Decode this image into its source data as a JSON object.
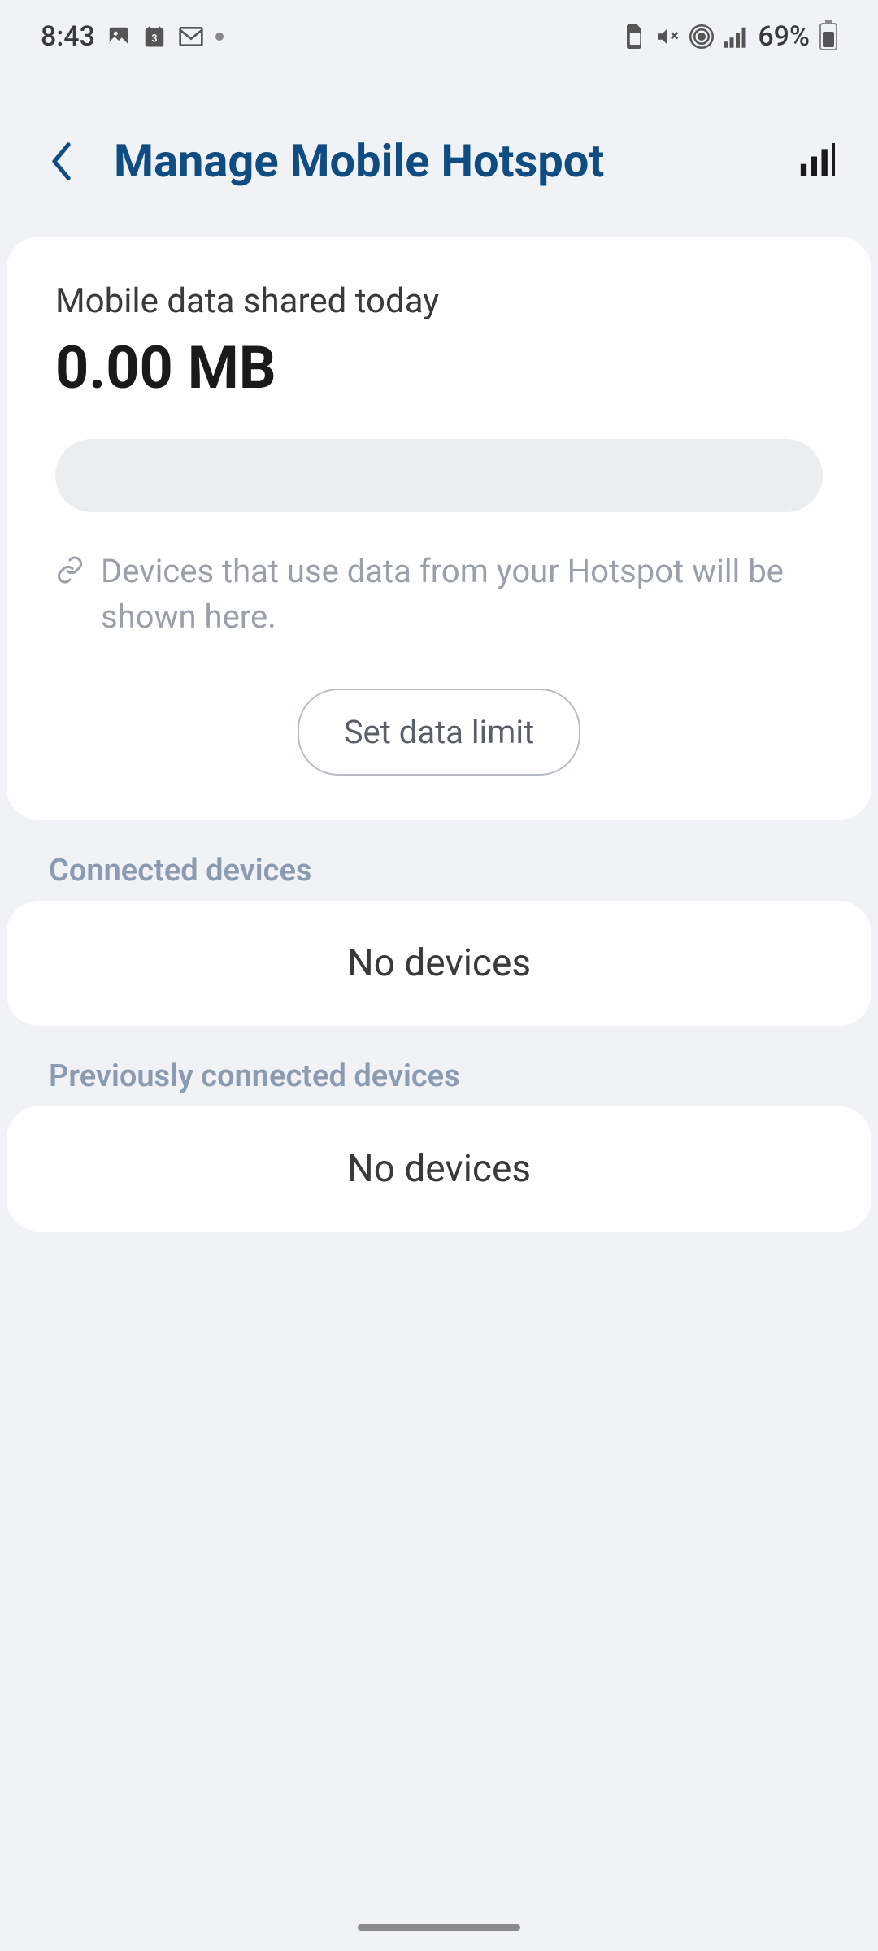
{
  "status_bar": {
    "time": "8:43",
    "battery_percent": "69%"
  },
  "header": {
    "title": "Manage Mobile Hotspot"
  },
  "data_card": {
    "label": "Mobile data shared today",
    "value": "0.00 MB",
    "info_text": "Devices that use data from your Hotspot will be shown here.",
    "set_limit_label": "Set data limit"
  },
  "connected_section": {
    "label": "Connected devices",
    "empty_text": "No devices"
  },
  "previous_section": {
    "label": "Previously connected devices",
    "empty_text": "No devices"
  }
}
